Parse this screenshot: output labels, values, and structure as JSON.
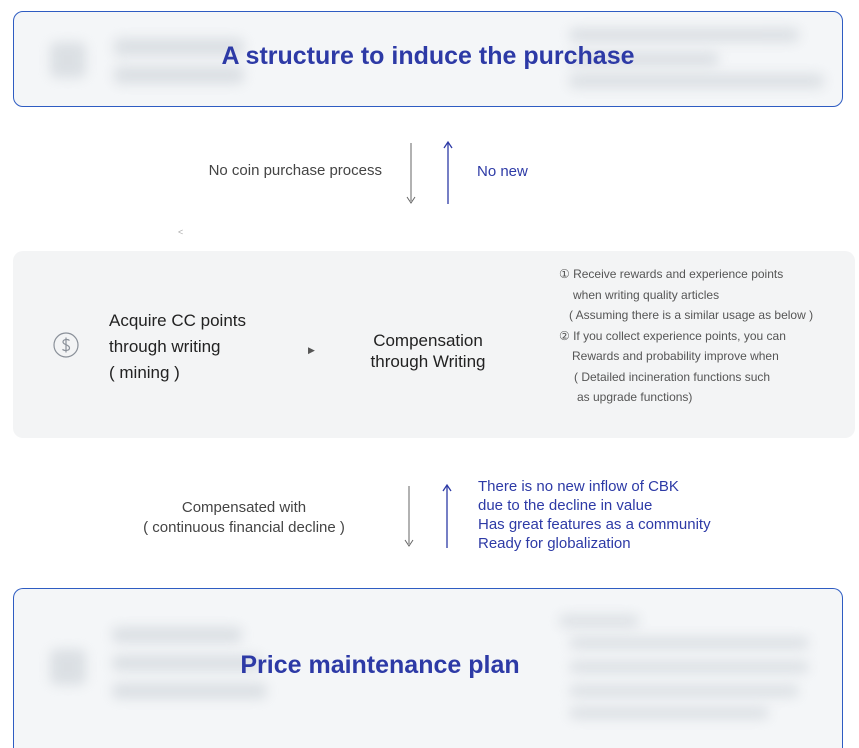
{
  "top_box": {
    "title": "A structure to induce the  purchase"
  },
  "flow1": {
    "left_label": "No coin purchase process",
    "right_label": "No new"
  },
  "small_mark": "<",
  "middle": {
    "icon": "dollar-circle-icon",
    "left_lines": [
      "Acquire CC points",
      "through writing",
      "( mining )"
    ],
    "center_lines": [
      "Compensation",
      "through Writing"
    ],
    "notes": [
      "① Receive rewards and experience points",
      "   when writing quality articles",
      "  ( Assuming there is a similar usage as below )",
      "② If you collect experience points, you can",
      "   Rewards and probability improve when",
      "   ( Detailed incineration functions such",
      "    as upgrade functions)"
    ]
  },
  "flow2": {
    "left_lines": [
      "Compensated with",
      "( continuous financial decline )"
    ],
    "right_lines": [
      "There is no new inflow of CBK",
      "due to the decline in value",
      "Has great features as a community",
      "Ready for globalization"
    ]
  },
  "bottom_box": {
    "title": "Price maintenance plan"
  },
  "colors": {
    "accent": "#2d3aa6",
    "border": "#2e5cc2",
    "panel": "#f3f4f5"
  }
}
